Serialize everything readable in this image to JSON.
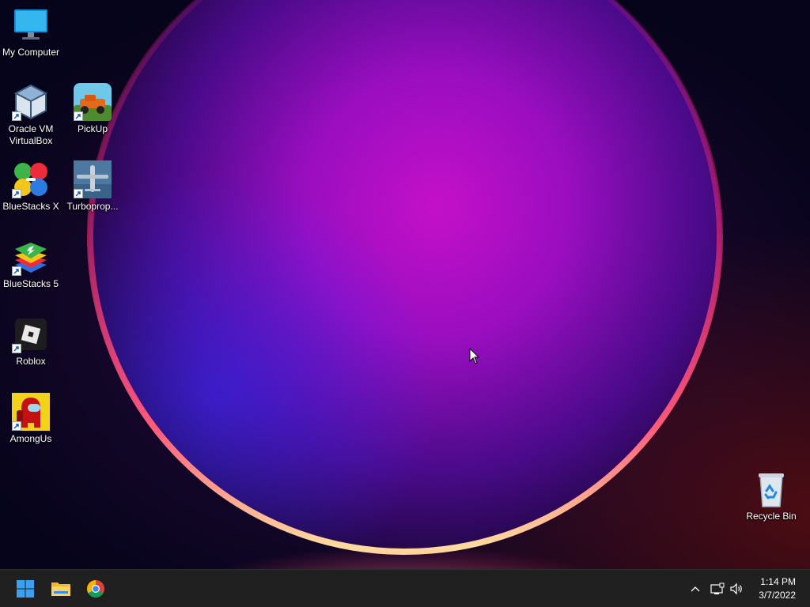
{
  "desktop": {
    "icons": [
      {
        "id": "my-computer",
        "label": "My Computer",
        "icon": "monitor-icon"
      },
      {
        "id": "virtualbox",
        "label": "Oracle VM VirtualBox",
        "icon": "virtualbox-icon"
      },
      {
        "id": "pickup",
        "label": "PickUp",
        "icon": "pickup-game-icon"
      },
      {
        "id": "bluestacks-x",
        "label": "BlueStacks X",
        "icon": "bluestacks-x-icon"
      },
      {
        "id": "turboprop",
        "label": "Turboprop...",
        "icon": "turboprop-plane-icon"
      },
      {
        "id": "bluestacks-5",
        "label": "BlueStacks 5",
        "icon": "bluestacks-5-icon"
      },
      {
        "id": "roblox",
        "label": "Roblox",
        "icon": "roblox-icon"
      },
      {
        "id": "amongus",
        "label": "AmongUs",
        "icon": "amongus-icon"
      },
      {
        "id": "recycle-bin",
        "label": "Recycle Bin",
        "icon": "recycle-bin-icon"
      }
    ]
  },
  "taskbar": {
    "pinned": [
      {
        "id": "start",
        "icon": "windows-start-icon"
      },
      {
        "id": "file-explorer",
        "icon": "folder-icon"
      },
      {
        "id": "chrome",
        "icon": "chrome-icon"
      }
    ],
    "tray": {
      "icons": [
        "chevron-up-icon",
        "network-icon",
        "volume-icon"
      ],
      "time": "1:14 PM",
      "date": "3/7/2022"
    }
  },
  "colors": {
    "taskbar_bg": "#202020",
    "wallpaper_glow": "#b010c0",
    "wallpaper_rim": "#ff3a6a",
    "windows_blue": "#3aa0f0"
  }
}
